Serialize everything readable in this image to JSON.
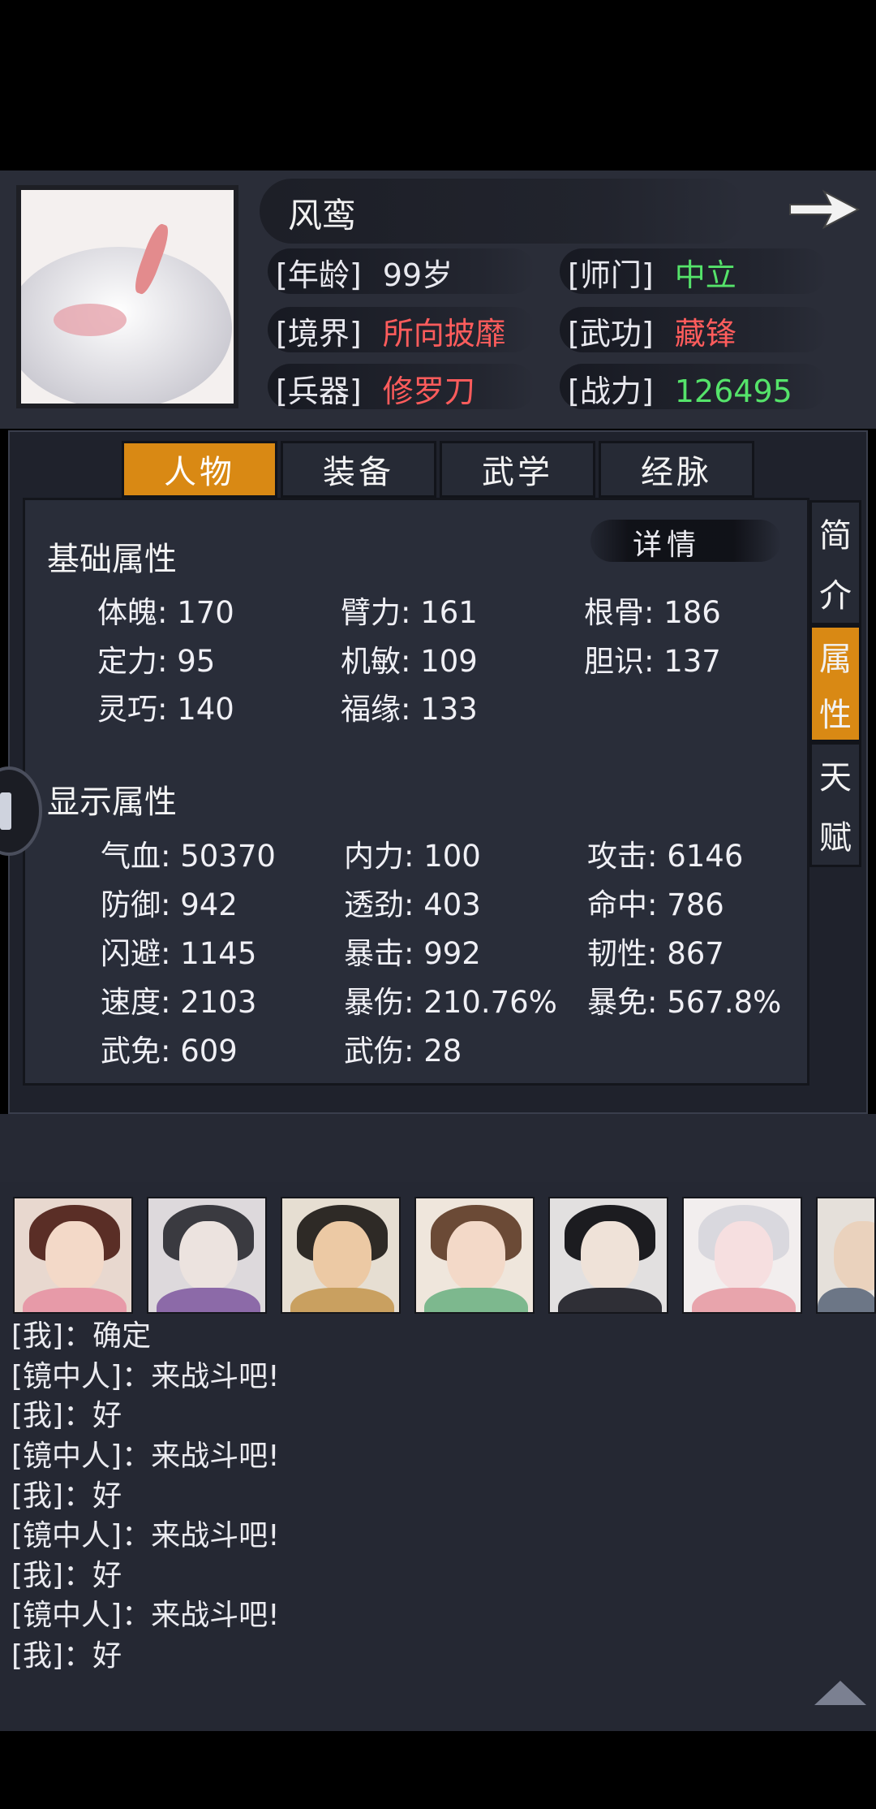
{
  "hero": {
    "name": "风鸾",
    "age_label": "[年龄]",
    "age": "99岁",
    "sect_label": "[师门]",
    "sect": "中立",
    "realm_label": "[境界]",
    "realm": "所向披靡",
    "skill_label": "[武功]",
    "skill": "藏锋",
    "weapon_label": "[兵器]",
    "weapon": "修罗刀",
    "power_label": "[战力]",
    "power": "126495"
  },
  "tabs": [
    "人物",
    "装备",
    "武学",
    "经脉"
  ],
  "side_tabs": [
    {
      "chars": [
        "简",
        "介"
      ]
    },
    {
      "chars": [
        "属",
        "性"
      ]
    },
    {
      "chars": [
        "天",
        "赋"
      ]
    }
  ],
  "detail_label": "详情",
  "basic": {
    "title": "基础属性",
    "stats": [
      "体魄: 170",
      "臂力: 161",
      "根骨: 186",
      "定力: 95",
      "机敏: 109",
      "胆识: 137",
      "灵巧: 140",
      "福缘: 133"
    ]
  },
  "display": {
    "title": "显示属性",
    "stats": [
      "气血: 50370",
      "内力: 100",
      "攻击: 6146",
      "防御: 942",
      "透劲: 403",
      "命中: 786",
      "闪避: 1145",
      "暴击: 992",
      "韧性: 867",
      "速度: 2103",
      "暴伤: 210.76%",
      "暴免: 567.8%",
      "武免: 609",
      "武伤: 28"
    ]
  },
  "chat": [
    "[我]：确定",
    "[镜中人]：来战斗吧!",
    "[我]：好",
    "[镜中人]：来战斗吧!",
    "[我]：好",
    "[镜中人]：来战斗吧!",
    "[我]：好",
    "[镜中人]：来战斗吧!",
    "[我]：好"
  ],
  "colors": {
    "accent": "#d98914",
    "red_value": "#ff5c5c",
    "green_value": "#55e36a",
    "panel_bg": "#292d39"
  }
}
